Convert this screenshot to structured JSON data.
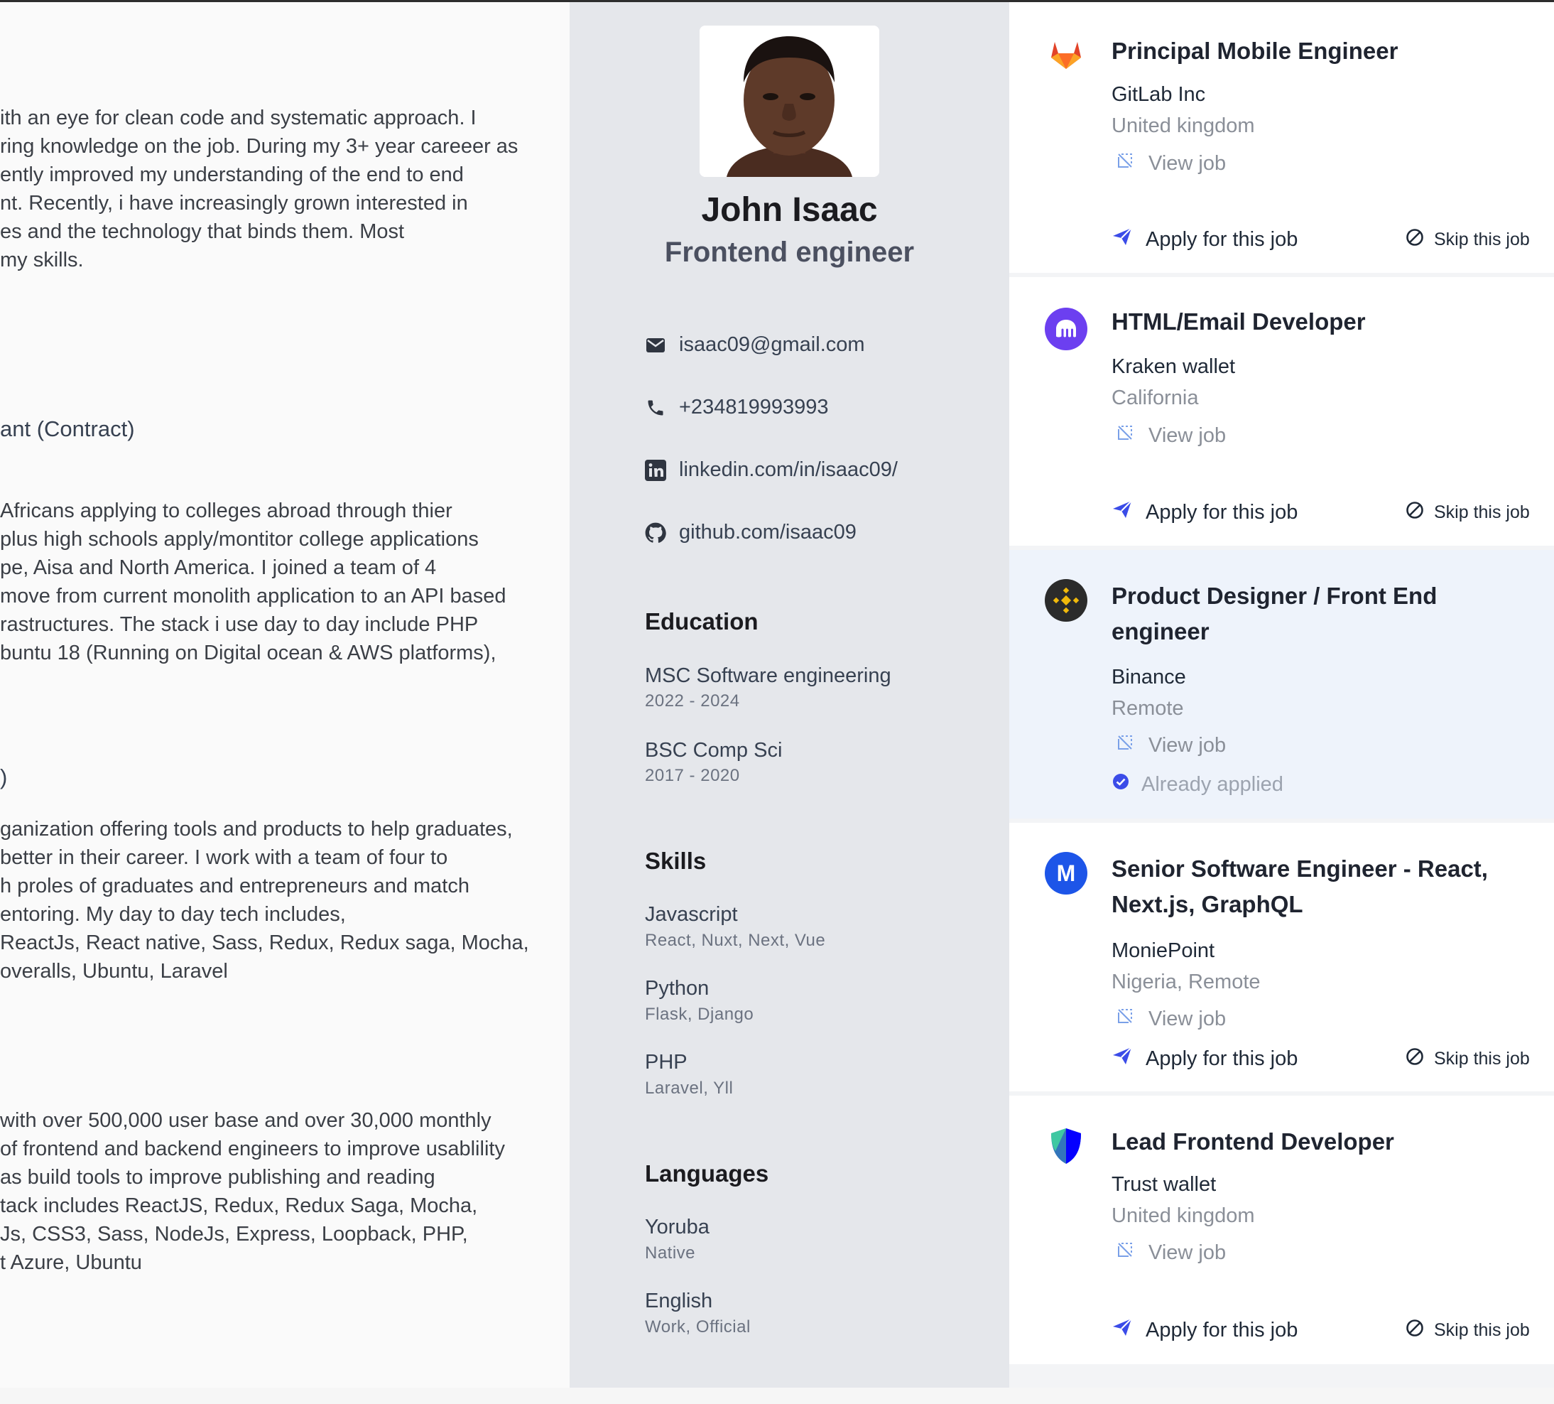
{
  "summary": {
    "lines": [
      "ith an eye for clean code and systematic approach. I",
      "ring knowledge on the job. During my 3+ year careeer as",
      "ently improved my understanding of the end to end",
      "nt. Recently, i have increasingly grown interested in",
      "es and the technology that binds them. Most",
      "my skills."
    ]
  },
  "experience": [
    {
      "heading": "ant (Contract)",
      "lines": [
        " Africans applying to colleges abroad through thier",
        " plus high schools apply/montitor college applications",
        "pe, Aisa and North America. I joined a team of 4",
        "move from current monolith application to an API based",
        "rastructures. The stack i use day to day include PHP",
        "buntu 18 (Running on Digital ocean & AWS platforms),"
      ]
    },
    {
      "heading": ")",
      "lines": [
        "ganization offering tools and products to help graduates,",
        " better in their career. I work with a team of four to",
        "h proles of graduates and entrepreneurs and match",
        "entoring. My day to day tech includes,",
        "ReactJs, React native, Sass, Redux, Redux saga, Mocha,",
        "overalls, Ubuntu, Laravel"
      ]
    },
    {
      "lines": [
        " with over 500,000 user base and over 30,000 monthly",
        "of frontend and backend engineers to improve usablility",
        "as build tools to improve publishing and reading",
        "tack includes ReactJS, Redux, Redux Saga, Mocha,",
        "Js, CSS3, Sass, NodeJs, Express, Loopback, PHP,",
        "t Azure, Ubuntu"
      ]
    }
  ],
  "profile": {
    "name": "John Isaac",
    "role": "Frontend engineer",
    "contacts": [
      {
        "icon": "mail-icon",
        "text": "isaac09@gmail.com"
      },
      {
        "icon": "phone-icon",
        "text": "+234819993993"
      },
      {
        "icon": "linkedin-icon",
        "text": "linkedin.com/in/isaac09/"
      },
      {
        "icon": "github-icon",
        "text": "github.com/isaac09"
      }
    ],
    "education_title": "Education",
    "education": [
      {
        "title": "MSC Software engineering",
        "sub": "2022 - 2024"
      },
      {
        "title": "BSC Comp Sci",
        "sub": "2017 - 2020"
      }
    ],
    "skills_title": "Skills",
    "skills": [
      {
        "title": "Javascript",
        "sub": "React, Nuxt, Next, Vue"
      },
      {
        "title": "Python",
        "sub": "Flask, Django"
      },
      {
        "title": "PHP",
        "sub": "Laravel, Yll"
      }
    ],
    "languages_title": "Languages",
    "languages": [
      {
        "title": "Yoruba",
        "sub": "Native"
      },
      {
        "title": "English",
        "sub": "Work, Official"
      }
    ]
  },
  "jobs": {
    "view_label": "View job",
    "apply_label": "Apply for this job",
    "skip_label": "Skip this job",
    "applied_label": "Already applied",
    "items": [
      {
        "title": "Principal Mobile Engineer",
        "company": "GitLab Inc",
        "location": "United kingdom",
        "logo": "gitlab-icon",
        "applied": false
      },
      {
        "title": "HTML/Email Developer",
        "company": "Kraken wallet",
        "location": "California",
        "logo": "kraken-icon",
        "applied": false
      },
      {
        "title": "Product Designer / Front End engineer",
        "company": "Binance",
        "location": "Remote",
        "logo": "binance-icon",
        "applied": true
      },
      {
        "title": "Senior Software Engineer - React, Next.js, GraphQL",
        "company": "MoniePoint",
        "location": "Nigeria, Remote",
        "logo": "moniepoint-icon",
        "applied": false
      },
      {
        "title": "Lead Frontend Developer",
        "company": "Trust wallet",
        "location": "United kingdom",
        "logo": "trustwallet-icon",
        "applied": false
      }
    ]
  },
  "colors": {
    "accent": "#3b4ce8",
    "applied_bg": "#eef3fb",
    "profile_bg": "#e5e7eb"
  }
}
